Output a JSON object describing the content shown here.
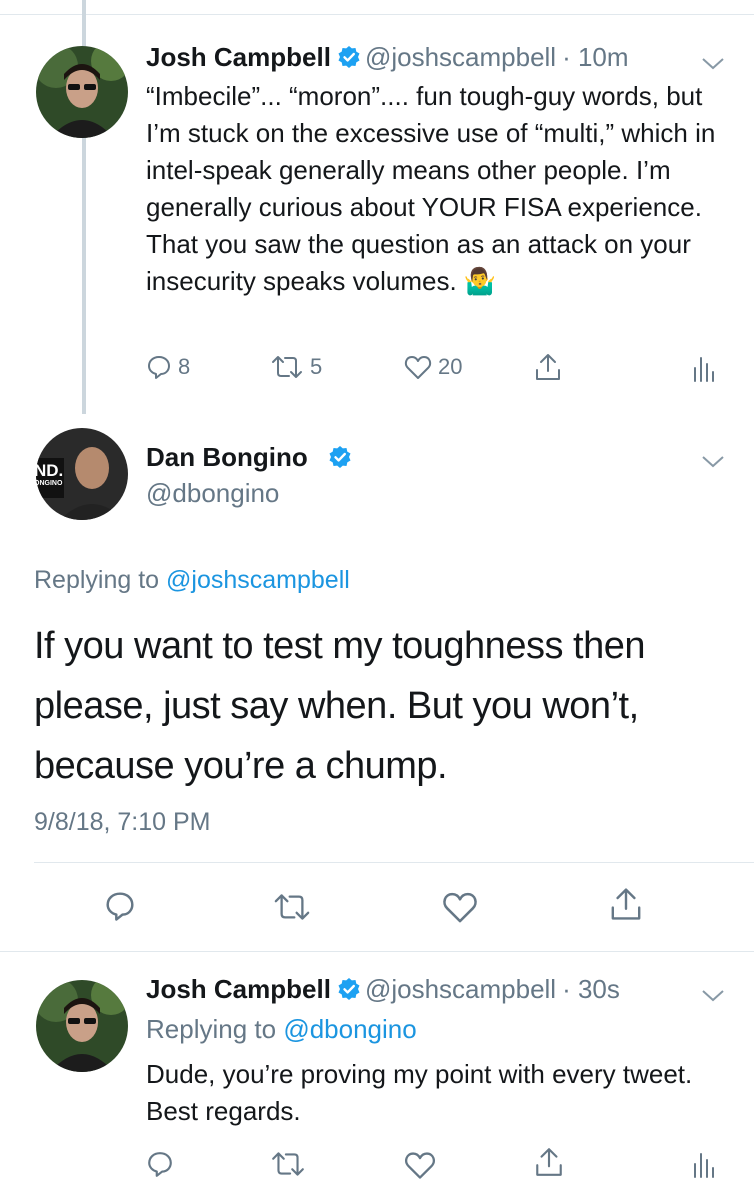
{
  "tweet1": {
    "author_name": "Josh Campbell",
    "author_handle": "@joshscampbell",
    "time": "· 10m",
    "text": "“Imbecile”... “moron”.... fun tough-guy words, but I’m stuck on the excessive use of “multi,” which in intel-speak generally means other people. I’m generally curious about YOUR FISA experience. That you saw the question as an attack on your insecurity speaks volumes.",
    "emoji": "🤷‍♂️",
    "reply_count": "8",
    "retweet_count": "5",
    "like_count": "20"
  },
  "tweet2": {
    "author_name": "Dan Bongino",
    "author_handle": "@dbongino",
    "avatar_text_1": "ND.",
    "avatar_text_2": "ONGINO",
    "replying_label": "Replying to",
    "replying_handle": "@joshscampbell",
    "text": "If you want to test my toughness then please, just say when. But you won’t, because you’re a chump.",
    "timestamp": "9/8/18, 7:10 PM"
  },
  "tweet3": {
    "author_name": "Josh Campbell",
    "author_handle": "@joshscampbell",
    "time": "· 30s",
    "replying_label": "Replying to",
    "replying_handle": "@dbongino",
    "text": "Dude, you’re proving my point with every tweet. Best regards."
  },
  "colors": {
    "link": "#1b95e0",
    "secondary_text": "#657786",
    "divider": "#e1e8ed",
    "thread_line": "#ccd6dd",
    "verified": "#1da1f2"
  }
}
